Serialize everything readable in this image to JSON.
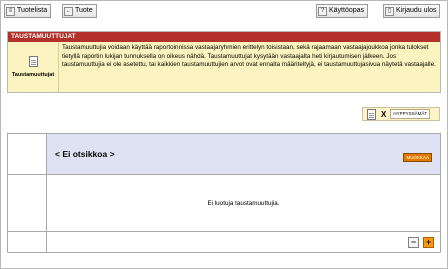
{
  "toolbar": {
    "product_list": "Tuotelista",
    "support": "Tuote",
    "help": "Käyttöopas",
    "logout": "Kirjaudu ulos"
  },
  "panel": {
    "title": "TAUSTAMUUTTUJAT",
    "icon_label": "Taustamuuttujat",
    "description": "Taustamuuttujia voidaan käyttää raportoinnissa vastaajaryhmien erittelyn toisistaan, sekä rajaamaan vastaajajoukkoa jonka tulokset tietyllä raportin lukijan tunnuksella on oikeus nähdä. Taustamuuttujat kysytään vastaajalta heti kirjautumisen jälkeen. Jos taustamuuttujia ei ole asetettu, tai kaikkien taustamuuttujien arvot ovat ennalta määriteltyjä, ei taustamuuttujasivua näytetä vastaajalle."
  },
  "tools": {
    "x_label": "X",
    "approve_label": "HYPPYSSÄMÄT"
  },
  "section": {
    "title": "< Ei otsikkoa >",
    "edit_badge": "MUOKKAA",
    "empty_message": "Ei luotuja taustamuuttujia."
  },
  "controls": {
    "minus": "−",
    "plus": "+"
  },
  "colors": {
    "header_red": "#b3312a",
    "panel_yellow": "#fcf4c0",
    "section_blue": "#dfe2f3",
    "accent_orange": "#f39c12"
  }
}
